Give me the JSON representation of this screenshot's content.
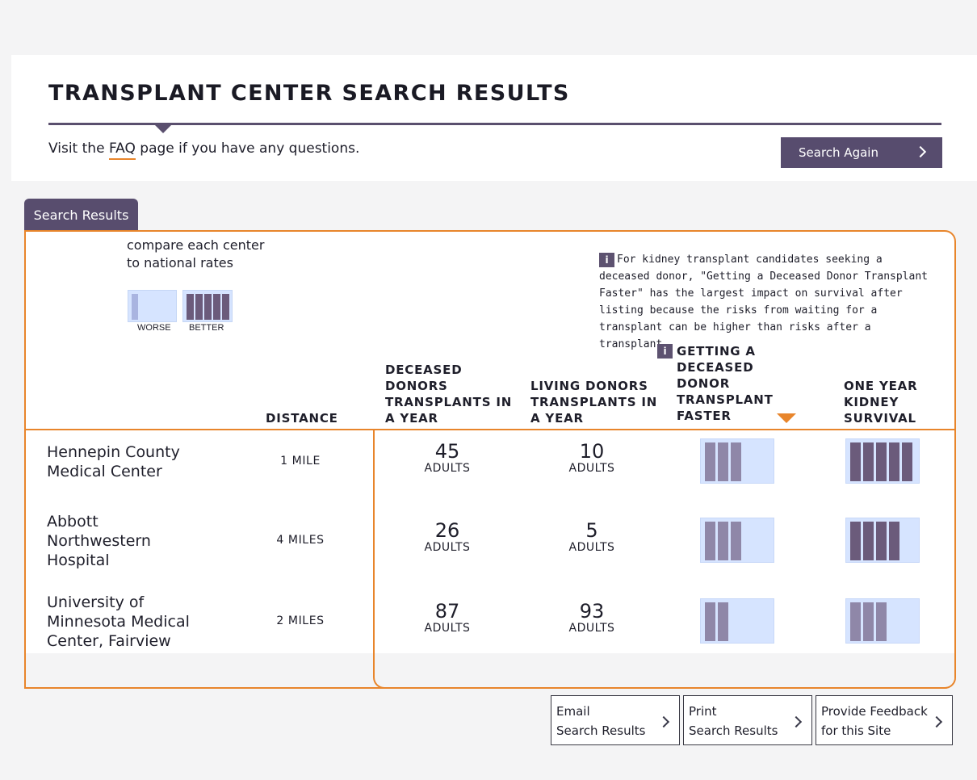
{
  "header": {
    "title": "TRANSPLANT CENTER SEARCH RESULTS",
    "faq_prefix": "Visit the ",
    "faq_link": "FAQ",
    "faq_suffix": " page if you have any questions.",
    "search_again": "Search Again"
  },
  "tab": {
    "label": "Search Results"
  },
  "legend": {
    "text": "compare each center to national rates",
    "worse_label": "WORSE",
    "better_label": "BETTER",
    "worse_level": 1,
    "better_level": 5
  },
  "info_note": {
    "icon": "i",
    "text": "For kidney transplant candidates seeking a deceased donor, \"Getting a Deceased Donor Transplant Faster\" has the largest impact on survival after listing because the risks from waiting for a transplant can be higher than risks after a transplant."
  },
  "columns": {
    "distance": "DISTANCE",
    "deceased": "DECEASED DONORS TRANSPLANTS IN A YEAR",
    "living": "LIVING DONORS TRANSPLANTS IN A YEAR",
    "faster": "GETTING A DECEASED DONOR TRANSPLANT FASTER",
    "survival": "ONE YEAR KIDNEY SURVIVAL"
  },
  "rows": [
    {
      "name": "Hennepin County Medical Center",
      "distance": "1 MILE",
      "deceased": "45",
      "deceased_unit": "ADULTS",
      "living": "10",
      "living_unit": "ADULTS",
      "faster_level": 3,
      "survival_level": 5
    },
    {
      "name": "Abbott Northwestern Hospital",
      "distance": "4 MILES",
      "deceased": "26",
      "deceased_unit": "ADULTS",
      "living": "5",
      "living_unit": "ADULTS",
      "faster_level": 3,
      "survival_level": 4
    },
    {
      "name": "University of Minnesota Medical Center, Fairview",
      "distance": "2 MILES",
      "deceased": "87",
      "deceased_unit": "ADULTS",
      "living": "93",
      "living_unit": "ADULTS",
      "faster_level": 2,
      "survival_level": 3
    }
  ],
  "footer": {
    "email": [
      "Email",
      "Search Results"
    ],
    "print": [
      "Print",
      "Search Results"
    ],
    "feedback": [
      "Provide Feedback",
      "for this Site"
    ]
  },
  "colors": {
    "accent": "#e8852b",
    "brand": "#584d6e",
    "meter_bg": "#d6e4ff",
    "bar_strong": "#6b5b7b",
    "bar_mid": "#8f87a8",
    "bar_weak": "#a9b4e0"
  }
}
